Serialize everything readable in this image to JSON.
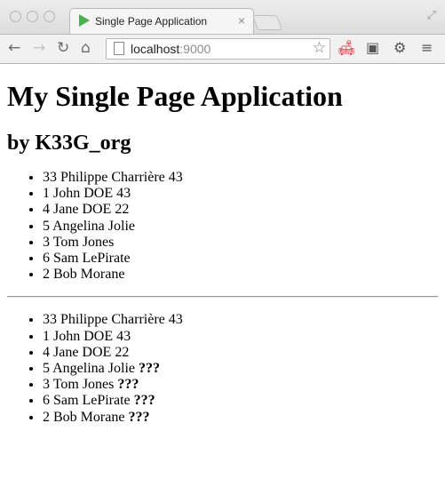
{
  "browser": {
    "tab_title": "Single Page Application",
    "tab_close": "×",
    "url_host": "localhost",
    "url_port": ":9000",
    "colors": {
      "favicon": "#4caf50",
      "ext_red": "#d32f2f"
    },
    "icons": [
      "back-icon",
      "forward-icon",
      "reload-icon",
      "home-icon",
      "page-icon",
      "star-icon",
      "couch-icon",
      "evernote-icon",
      "gear-icon",
      "menu-icon"
    ]
  },
  "page": {
    "title": "My Single Page Application",
    "subtitle": "by K33G_org",
    "list1": [
      "33 Philippe Charrière 43",
      "1 John DOE 43",
      "4 Jane DOE 22",
      "5 Angelina Jolie",
      "3 Tom Jones",
      "6 Sam LePirate",
      "2 Bob Morane"
    ],
    "list2": [
      {
        "text": "33 Philippe Charrière 43",
        "suffix": ""
      },
      {
        "text": "1 John DOE 43",
        "suffix": ""
      },
      {
        "text": "4 Jane DOE 22",
        "suffix": ""
      },
      {
        "text": "5 Angelina Jolie ",
        "suffix": "???"
      },
      {
        "text": "3 Tom Jones ",
        "suffix": "???"
      },
      {
        "text": "6 Sam LePirate ",
        "suffix": "???"
      },
      {
        "text": "2 Bob Morane ",
        "suffix": "???"
      }
    ]
  }
}
